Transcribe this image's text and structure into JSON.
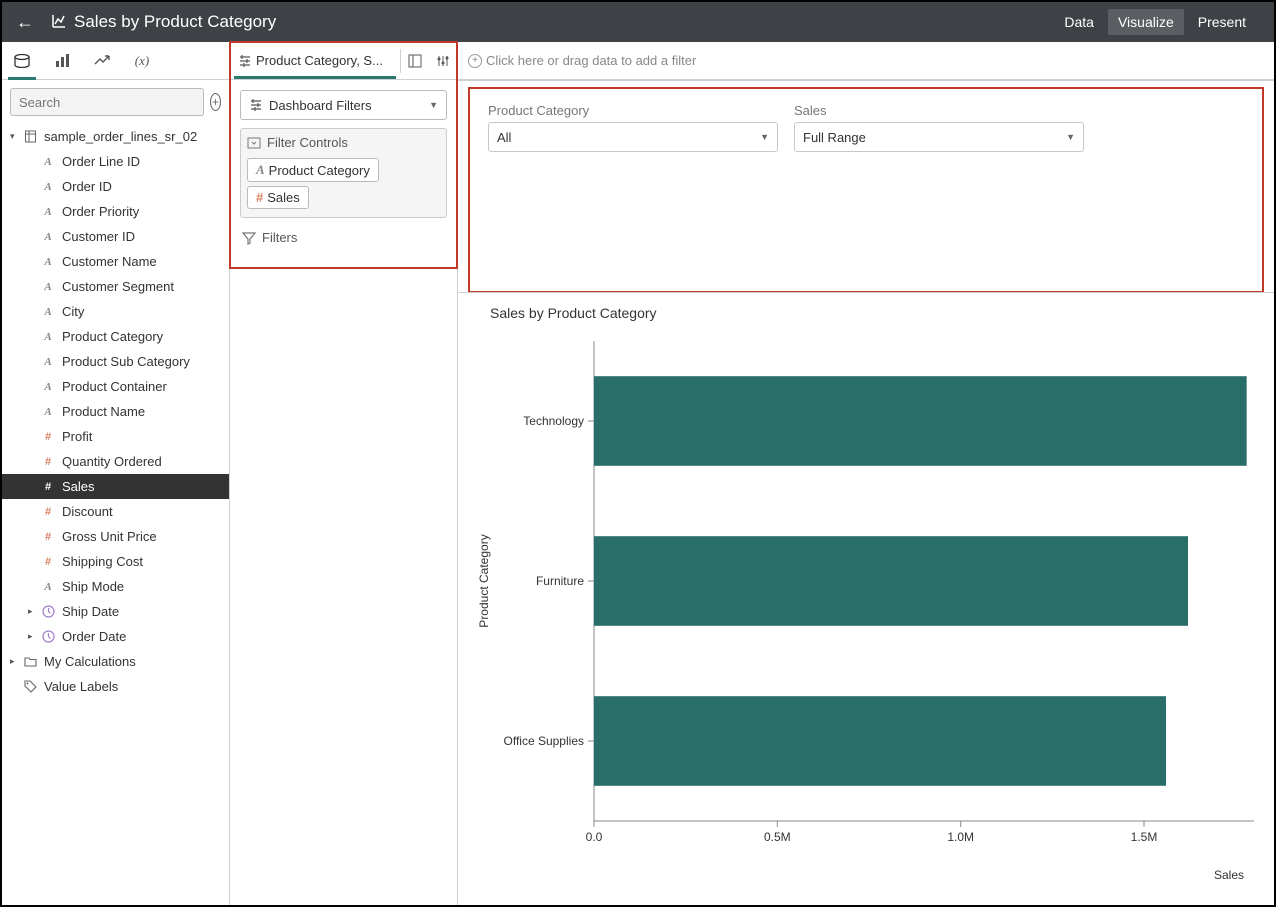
{
  "header": {
    "title": "Sales by Product Category",
    "tabs": {
      "data": "Data",
      "visualize": "Visualize",
      "present": "Present"
    }
  },
  "left": {
    "search_placeholder": "Search",
    "dataset": "sample_order_lines_sr_02",
    "columns": [
      {
        "name": "Order Line ID",
        "type": "A"
      },
      {
        "name": "Order ID",
        "type": "A"
      },
      {
        "name": "Order Priority",
        "type": "A"
      },
      {
        "name": "Customer ID",
        "type": "A"
      },
      {
        "name": "Customer Name",
        "type": "A"
      },
      {
        "name": "Customer Segment",
        "type": "A"
      },
      {
        "name": "City",
        "type": "A"
      },
      {
        "name": "Product Category",
        "type": "A"
      },
      {
        "name": "Product Sub Category",
        "type": "A"
      },
      {
        "name": "Product Container",
        "type": "A"
      },
      {
        "name": "Product Name",
        "type": "A"
      },
      {
        "name": "Profit",
        "type": "#"
      },
      {
        "name": "Quantity Ordered",
        "type": "#"
      },
      {
        "name": "Sales",
        "type": "#",
        "selected": true
      },
      {
        "name": "Discount",
        "type": "#"
      },
      {
        "name": "Gross Unit Price",
        "type": "#"
      },
      {
        "name": "Shipping Cost",
        "type": "#"
      },
      {
        "name": "Ship Mode",
        "type": "A"
      },
      {
        "name": "Ship Date",
        "type": "clock",
        "expandable": true
      },
      {
        "name": "Order Date",
        "type": "clock",
        "expandable": true
      }
    ],
    "my_calculations": "My Calculations",
    "value_labels": "Value Labels"
  },
  "mid": {
    "tab_label": "Product Category, S...",
    "dashboard_filters": "Dashboard Filters",
    "filter_controls": "Filter Controls",
    "chips": {
      "product_category": "Product Category",
      "sales": "Sales"
    },
    "filters": "Filters"
  },
  "content": {
    "filter_hint": "Click here or drag data to add a filter",
    "dash": {
      "product_category": {
        "label": "Product Category",
        "value": "All"
      },
      "sales": {
        "label": "Sales",
        "value": "Full Range"
      }
    },
    "chart_title": "Sales by Product Category"
  },
  "chart_data": {
    "type": "bar",
    "orientation": "horizontal",
    "title": "Sales by Product Category",
    "ylabel": "Product Category",
    "xlabel": "Sales",
    "xlim": [
      0,
      1800000
    ],
    "x_ticks": [
      0,
      500000,
      1000000,
      1500000
    ],
    "x_tick_labels": [
      "0.0",
      "0.5M",
      "1.0M",
      "1.5M"
    ],
    "categories": [
      "Technology",
      "Furniture",
      "Office Supplies"
    ],
    "values": [
      1780000,
      1620000,
      1560000
    ],
    "bar_color": "#2a6e6a"
  }
}
